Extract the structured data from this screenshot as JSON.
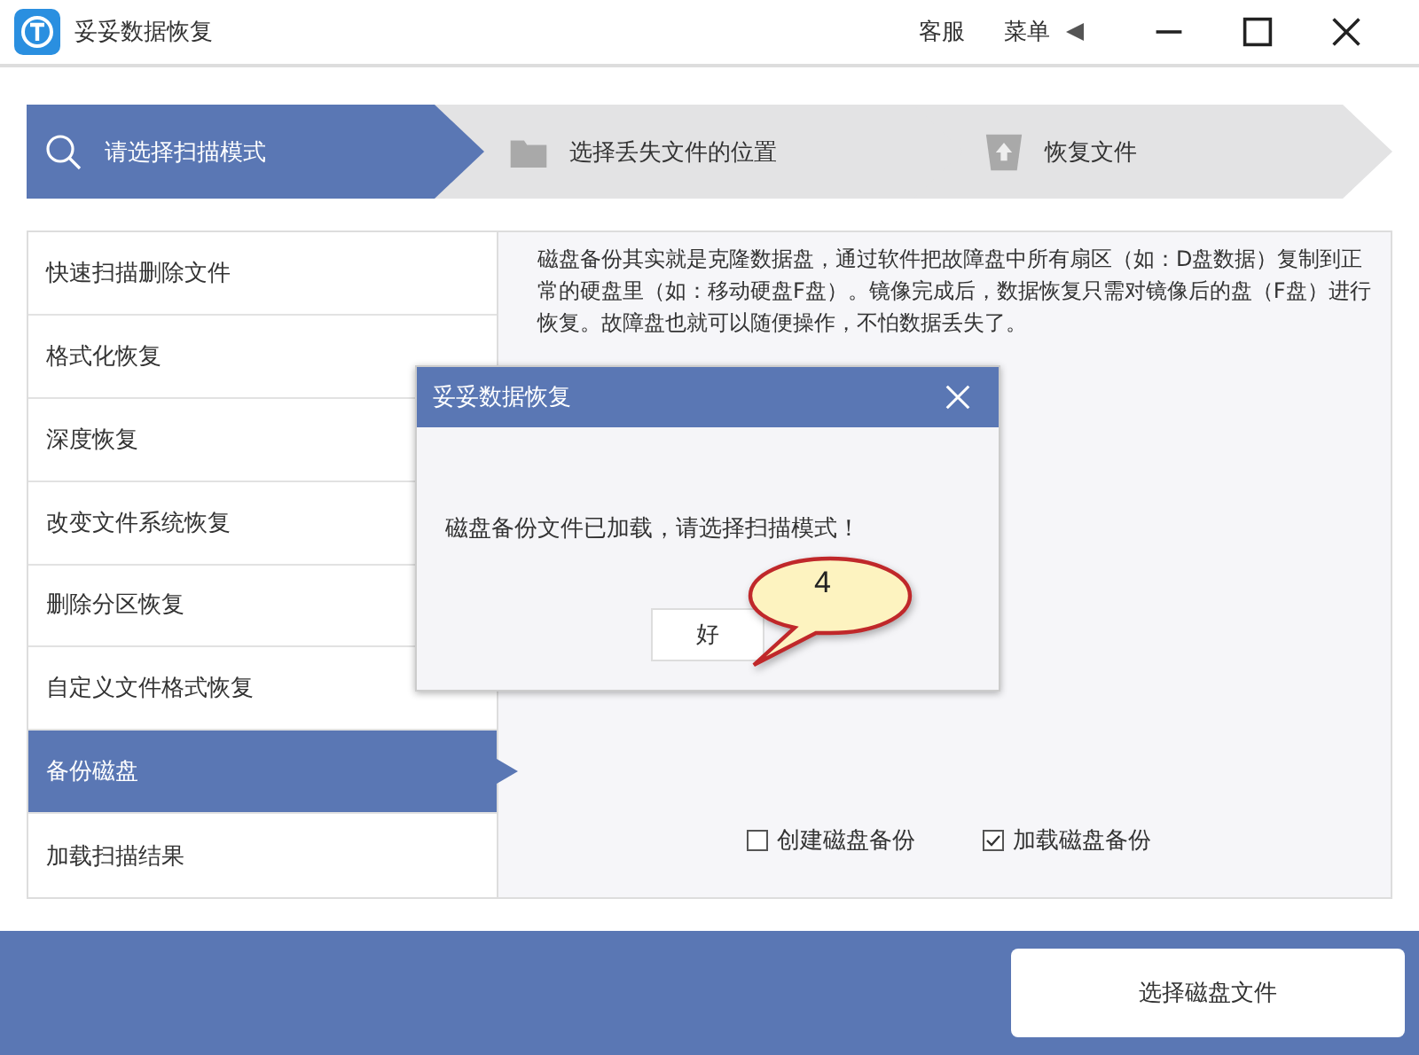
{
  "window": {
    "title": "妥妥数据恢复",
    "links": [
      "客服",
      "菜单"
    ]
  },
  "steps": [
    {
      "label": "请选择扫描模式",
      "selected": true
    },
    {
      "label": "选择丢失文件的位置",
      "selected": false
    },
    {
      "label": "恢复文件",
      "selected": false
    }
  ],
  "sidebar": {
    "items": [
      {
        "label": "快速扫描删除文件",
        "selected": false
      },
      {
        "label": "格式化恢复",
        "selected": false
      },
      {
        "label": "深度恢复",
        "selected": false
      },
      {
        "label": "改变文件系统恢复",
        "selected": false
      },
      {
        "label": "删除分区恢复",
        "selected": false
      },
      {
        "label": "自定义文件格式恢复",
        "selected": false
      },
      {
        "label": "备份磁盘",
        "selected": true
      },
      {
        "label": "加载扫描结果",
        "selected": false
      }
    ]
  },
  "content": {
    "description": "磁盘备份其实就是克隆数据盘，通过软件把故障盘中所有扇区（如：D盘数据）复制到正常的硬盘里（如：移动硬盘F盘）。镜像完成后，数据恢复只需对镜像后的盘（F盘）进行恢复。故障盘也就可以随便操作，不怕数据丢失了。",
    "options": [
      {
        "label": "创建磁盘备份",
        "checked": false
      },
      {
        "label": "加载磁盘备份",
        "checked": true
      }
    ]
  },
  "dialog": {
    "title": "妥妥数据恢复",
    "message": "磁盘备份文件已加载，请选择扫描模式！",
    "button": "好",
    "callout": "4"
  },
  "footer": {
    "button": "选择磁盘文件"
  }
}
